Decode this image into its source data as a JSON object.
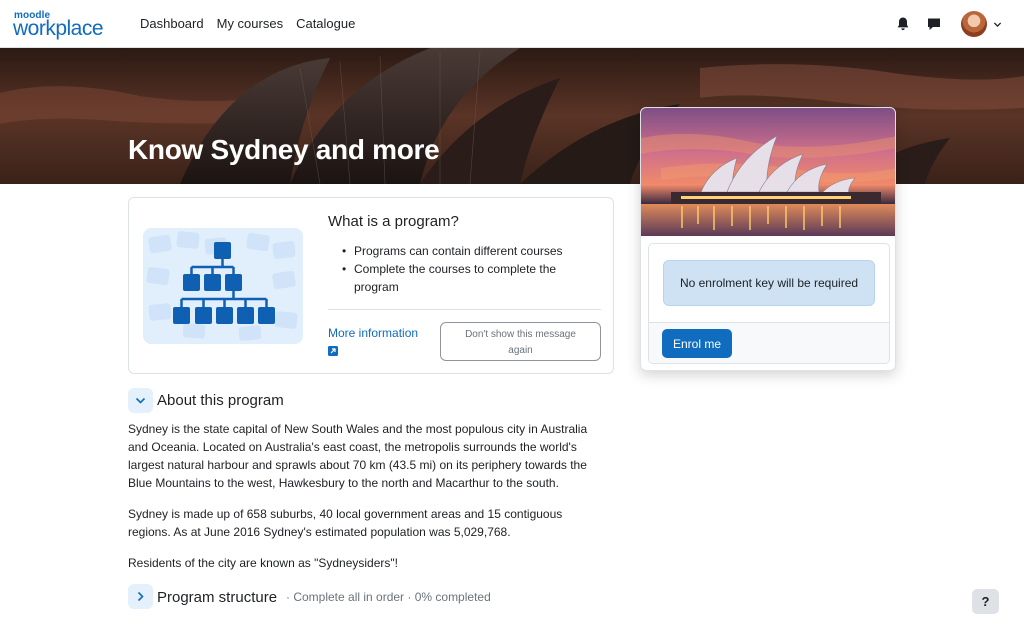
{
  "logo": {
    "brand_small": "moodle",
    "brand_large": "workplace"
  },
  "nav": {
    "items": [
      "Dashboard",
      "My courses",
      "Catalogue"
    ]
  },
  "header_icons": {
    "notifications": "bell-icon",
    "messages": "chat-bubble-icon",
    "user_menu": "chevron-down-icon"
  },
  "hero": {
    "title": "Know Sydney and more"
  },
  "info_card": {
    "title": "What is a program?",
    "bullets": [
      "Programs can contain different courses",
      "Complete the courses to complete the program"
    ],
    "more_info": "More information",
    "dont_show_line1": "Don't show this message",
    "dont_show_line2": "again"
  },
  "about": {
    "title": "About this program",
    "paragraphs": [
      "Sydney is the state capital of New South Wales and the most populous city in Australia and Oceania. Located on Australia's east coast, the metropolis surrounds the world's largest natural harbour and sprawls about 70 km (43.5 mi) on its periphery towards the Blue Mountains to the west, Hawkesbury to the north and Macarthur to the south.",
      "Sydney is made up of 658 suburbs, 40 local government areas and 15 contiguous regions. As at June 2016 Sydney's estimated population was 5,029,768.",
      "Residents of the city are known as \"Sydneysiders\"!"
    ]
  },
  "structure": {
    "title": "Program structure",
    "meta": "· Complete all in order · 0% completed"
  },
  "enrol": {
    "alert": "No enrolment key will be required",
    "button": "Enrol me"
  },
  "help": {
    "label": "?"
  },
  "colors": {
    "primary": "#0f6cbf",
    "alert_bg": "#cfe2f3",
    "toggle_bg": "#e4f0fb"
  }
}
